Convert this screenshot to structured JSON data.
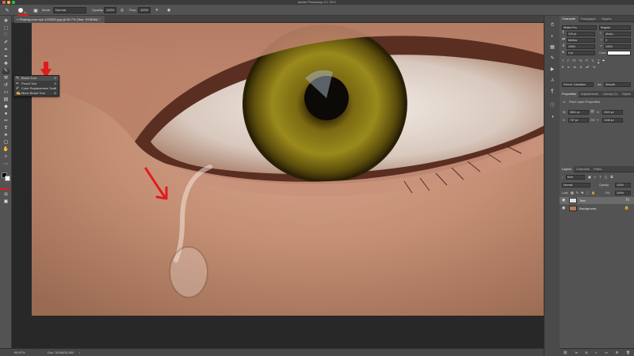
{
  "app": {
    "title": "Adobe Photoshop CC 2017"
  },
  "options_bar": {
    "brush_size": "10",
    "mode_label": "Mode:",
    "mode_value": "Normal",
    "opacity_label": "Opacity:",
    "opacity_value": "100%",
    "flow_label": "Flow:",
    "flow_value": "100%"
  },
  "document": {
    "tab_label": "Pixabay.com-eye-1132531.jpg @ 66.7% (Tear, RGB/8#) *"
  },
  "flyout": {
    "items": [
      {
        "label": "Brush Tool",
        "shortcut": "B"
      },
      {
        "label": "Pencil Tool",
        "shortcut": "B"
      },
      {
        "label": "Color Replacement Tool",
        "shortcut": "B"
      },
      {
        "label": "Mixer Brush Tool",
        "shortcut": "B"
      }
    ]
  },
  "status_bar": {
    "zoom": "66.67%",
    "doc": "Doc: 28.6M/31.6M"
  },
  "character_panel": {
    "tabs": [
      "Character",
      "Paragraph",
      "Glyphs"
    ],
    "font_family": "Minion Pro",
    "font_style": "Regular",
    "font_size": "120 pt",
    "leading": "(Auto)",
    "kerning": "Metrics",
    "tracking": "0",
    "vertical_scale": "100%",
    "horizontal_scale": "100%",
    "baseline": "0 pt",
    "color_label": "Color:",
    "language": "French: Canadian",
    "antialias": "Smooth"
  },
  "properties_panel": {
    "tabs": [
      "Properties",
      "Adjustments",
      "Library Co",
      "Styles"
    ],
    "title": "Pixel Layer Properties",
    "w_label": "W:",
    "w_value": "3631 px",
    "h_label": "H:",
    "h_value": "2024 px",
    "x_label": "X:",
    "x_value": "737 px",
    "y_label": "Y:",
    "y_value": "1048 px",
    "go_label": "GO"
  },
  "layers_panel": {
    "tabs": [
      "Layers",
      "Channels",
      "Paths"
    ],
    "filter_kind": "Kind",
    "blend_mode": "Normal",
    "opacity_label": "Opacity:",
    "opacity_value": "100%",
    "lock_label": "Lock:",
    "fill_label": "Fill:",
    "fill_value": "100%",
    "layers": [
      {
        "name": "Tear",
        "selected": true
      },
      {
        "name": "Background",
        "selected": false
      }
    ]
  },
  "colors": {
    "accent_red": "#e01b1b",
    "panel_bg": "#535353",
    "dark_bg": "#282828"
  }
}
